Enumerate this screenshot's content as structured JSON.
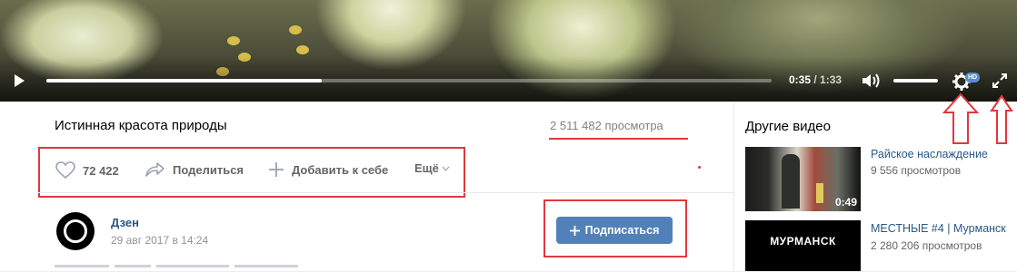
{
  "player": {
    "current_time": "0:35",
    "total_time": "1:33",
    "time_separator": " / ",
    "progress_fraction": 0.38,
    "volume_fraction": 1.0,
    "quality_badge": "HD"
  },
  "video": {
    "title": "Истинная красота природы",
    "views": "2 511 482 просмотра"
  },
  "actions": {
    "likes": "72 422",
    "share": "Поделиться",
    "add": "Добавить к себе",
    "more": "Ещё"
  },
  "author": {
    "name": "Дзен",
    "date": "29 авг 2017 в 14:24",
    "subscribe": "Подписаться"
  },
  "sidebar": {
    "title": "Другие видео",
    "videos": [
      {
        "title": "Райское наслаждение",
        "views": "9 556 просмотров",
        "duration": "0:49"
      },
      {
        "title": "МЕСТНЫЕ #4 | Мурманск",
        "views": "2 280 206 просмотров",
        "thumb_text": "МУРМАНСК"
      }
    ]
  },
  "colors": {
    "highlight": "#e0383e",
    "link": "#2a5885",
    "button": "#5181b8"
  }
}
